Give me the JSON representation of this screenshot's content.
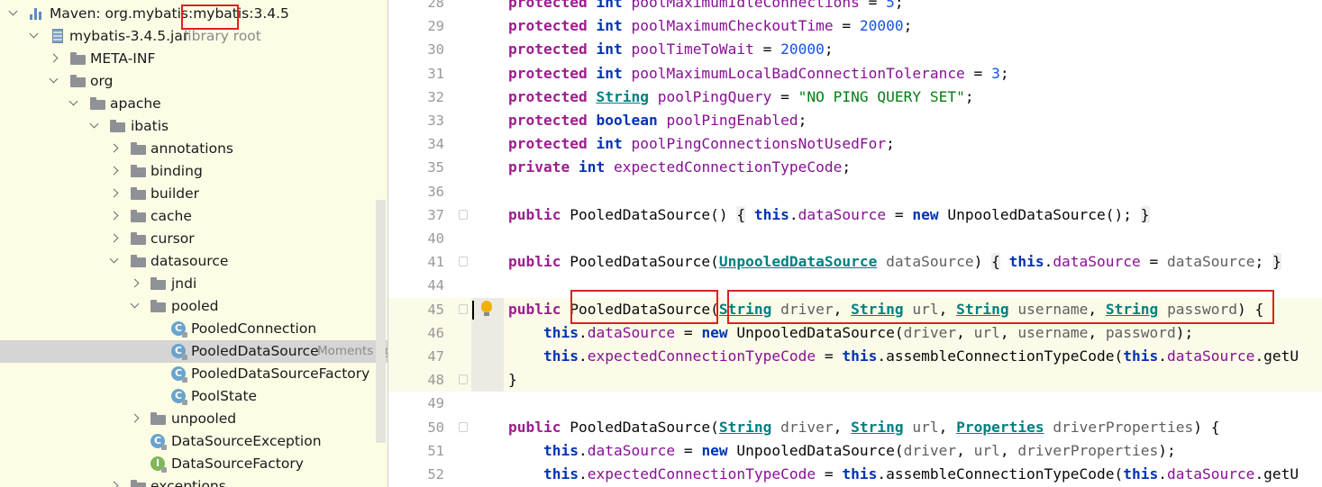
{
  "project_tree": {
    "root": {
      "label": "Maven: org.mybatis:mybatis:3.4.5"
    },
    "jar": {
      "label": "mybatis-3.4.5.jar",
      "hint": "library root"
    },
    "items": [
      {
        "label": "META-INF"
      },
      {
        "label": "org"
      },
      {
        "label": "apache"
      },
      {
        "label": "ibatis"
      },
      {
        "label": "annotations"
      },
      {
        "label": "binding"
      },
      {
        "label": "builder"
      },
      {
        "label": "cache"
      },
      {
        "label": "cursor"
      },
      {
        "label": "datasource"
      },
      {
        "label": "jndi"
      },
      {
        "label": "pooled"
      },
      {
        "label": "PooledConnection"
      },
      {
        "label": "PooledDataSource",
        "hint": "Moments ag"
      },
      {
        "label": "PooledDataSourceFactory"
      },
      {
        "label": "PoolState"
      },
      {
        "label": "unpooled"
      },
      {
        "label": "DataSourceException"
      },
      {
        "label": "DataSourceFactory"
      },
      {
        "label": "exceptions"
      }
    ],
    "icons": {
      "class": "C",
      "interface": "I"
    }
  },
  "editor": {
    "lines": [
      {
        "n": "28",
        "tokens": [
          [
            "k",
            "protected"
          ],
          [
            "t",
            " "
          ],
          [
            "k",
            "int"
          ],
          [
            "t",
            " "
          ],
          [
            "f",
            "poolMaximumIdleConnections"
          ],
          [
            "t",
            " = "
          ],
          [
            "n",
            "5"
          ],
          [
            "t",
            ";"
          ]
        ]
      },
      {
        "n": "29",
        "tokens": [
          [
            "k",
            "protected"
          ],
          [
            "t",
            " "
          ],
          [
            "k",
            "int"
          ],
          [
            "t",
            " "
          ],
          [
            "f",
            "poolMaximumCheckoutTime"
          ],
          [
            "t",
            " = "
          ],
          [
            "n",
            "20000"
          ],
          [
            "t",
            ";"
          ]
        ]
      },
      {
        "n": "30",
        "tokens": [
          [
            "k",
            "protected"
          ],
          [
            "t",
            " "
          ],
          [
            "k",
            "int"
          ],
          [
            "t",
            " "
          ],
          [
            "f",
            "poolTimeToWait"
          ],
          [
            "t",
            " = "
          ],
          [
            "n",
            "20000"
          ],
          [
            "t",
            ";"
          ]
        ]
      },
      {
        "n": "31",
        "tokens": [
          [
            "k",
            "protected"
          ],
          [
            "t",
            " "
          ],
          [
            "k",
            "int"
          ],
          [
            "t",
            " "
          ],
          [
            "f",
            "poolMaximumLocalBadConnectionTolerance"
          ],
          [
            "t",
            " = "
          ],
          [
            "n",
            "3"
          ],
          [
            "t",
            ";"
          ]
        ]
      },
      {
        "n": "32",
        "tokens": [
          [
            "k",
            "protected"
          ],
          [
            "t",
            " "
          ],
          [
            "y",
            "String"
          ],
          [
            "t",
            " "
          ],
          [
            "f",
            "poolPingQuery"
          ],
          [
            "t",
            " = "
          ],
          [
            "s",
            "\"NO PING QUERY SET\""
          ],
          [
            "t",
            ";"
          ]
        ]
      },
      {
        "n": "33",
        "tokens": [
          [
            "k",
            "protected"
          ],
          [
            "t",
            " "
          ],
          [
            "k",
            "boolean"
          ],
          [
            "t",
            " "
          ],
          [
            "f",
            "poolPingEnabled"
          ],
          [
            "t",
            ";"
          ]
        ]
      },
      {
        "n": "34",
        "tokens": [
          [
            "k",
            "protected"
          ],
          [
            "t",
            " "
          ],
          [
            "k",
            "int"
          ],
          [
            "t",
            " "
          ],
          [
            "f",
            "poolPingConnectionsNotUsedFor"
          ],
          [
            "t",
            ";"
          ]
        ]
      },
      {
        "n": "35",
        "tokens": [
          [
            "k",
            "private"
          ],
          [
            "t",
            " "
          ],
          [
            "k",
            "int"
          ],
          [
            "t",
            " "
          ],
          [
            "f",
            "expectedConnectionTypeCode"
          ],
          [
            "t",
            ";"
          ]
        ]
      },
      {
        "n": "36",
        "tokens": []
      },
      {
        "n": "37",
        "tokens": [
          [
            "k",
            "public"
          ],
          [
            "t",
            " PooledDataSource() "
          ],
          [
            "b",
            "{"
          ],
          [
            "t",
            " "
          ],
          [
            "k",
            "this"
          ],
          [
            "t",
            "."
          ],
          [
            "f",
            "dataSource"
          ],
          [
            "t",
            " = "
          ],
          [
            "k",
            "new"
          ],
          [
            "t",
            " UnpooledDataSource(); "
          ],
          [
            "b",
            "}"
          ]
        ]
      },
      {
        "n": "40",
        "tokens": []
      },
      {
        "n": "41",
        "tokens": [
          [
            "k",
            "public"
          ],
          [
            "t",
            " PooledDataSource("
          ],
          [
            "y",
            "UnpooledDataSource"
          ],
          [
            "t",
            " "
          ],
          [
            "p",
            "dataSource"
          ],
          [
            "t",
            ") "
          ],
          [
            "b",
            "{"
          ],
          [
            "t",
            " "
          ],
          [
            "k",
            "this"
          ],
          [
            "t",
            "."
          ],
          [
            "f",
            "dataSource"
          ],
          [
            "t",
            " = "
          ],
          [
            "p",
            "dataSource"
          ],
          [
            "t",
            "; "
          ],
          [
            "b",
            "}"
          ]
        ]
      },
      {
        "n": "44",
        "tokens": []
      },
      {
        "n": "45",
        "tokens": [
          [
            "k",
            "public"
          ],
          [
            "t",
            " PooledDataSource("
          ],
          [
            "y",
            "String"
          ],
          [
            "t",
            " "
          ],
          [
            "p",
            "driver"
          ],
          [
            "t",
            ", "
          ],
          [
            "y",
            "String"
          ],
          [
            "t",
            " "
          ],
          [
            "p",
            "url"
          ],
          [
            "t",
            ", "
          ],
          [
            "y",
            "String"
          ],
          [
            "t",
            " "
          ],
          [
            "p",
            "username"
          ],
          [
            "t",
            ", "
          ],
          [
            "y",
            "String"
          ],
          [
            "t",
            " "
          ],
          [
            "p",
            "password"
          ],
          [
            "t",
            ") {"
          ]
        ]
      },
      {
        "n": "46",
        "tokens": [
          [
            "t",
            "    "
          ],
          [
            "k",
            "this"
          ],
          [
            "t",
            "."
          ],
          [
            "f",
            "dataSource"
          ],
          [
            "t",
            " = "
          ],
          [
            "k",
            "new"
          ],
          [
            "t",
            " UnpooledDataSource("
          ],
          [
            "p",
            "driver"
          ],
          [
            "t",
            ", "
          ],
          [
            "p",
            "url"
          ],
          [
            "t",
            ", "
          ],
          [
            "p",
            "username"
          ],
          [
            "t",
            ", "
          ],
          [
            "p",
            "password"
          ],
          [
            "t",
            ");"
          ]
        ]
      },
      {
        "n": "47",
        "tokens": [
          [
            "t",
            "    "
          ],
          [
            "k",
            "this"
          ],
          [
            "t",
            "."
          ],
          [
            "f",
            "expectedConnectionTypeCode"
          ],
          [
            "t",
            " = "
          ],
          [
            "k",
            "this"
          ],
          [
            "t",
            ".assembleConnectionTypeCode("
          ],
          [
            "k",
            "this"
          ],
          [
            "t",
            "."
          ],
          [
            "f",
            "dataSource"
          ],
          [
            "t",
            ".getU"
          ]
        ]
      },
      {
        "n": "48",
        "tokens": [
          [
            "t",
            "}"
          ]
        ]
      },
      {
        "n": "49",
        "tokens": []
      },
      {
        "n": "50",
        "tokens": [
          [
            "k",
            "public"
          ],
          [
            "t",
            " PooledDataSource("
          ],
          [
            "y",
            "String"
          ],
          [
            "t",
            " "
          ],
          [
            "p",
            "driver"
          ],
          [
            "t",
            ", "
          ],
          [
            "y",
            "String"
          ],
          [
            "t",
            " "
          ],
          [
            "p",
            "url"
          ],
          [
            "t",
            ", "
          ],
          [
            "y",
            "Properties"
          ],
          [
            "t",
            " "
          ],
          [
            "p",
            "driverProperties"
          ],
          [
            "t",
            ") {"
          ]
        ]
      },
      {
        "n": "51",
        "tokens": [
          [
            "t",
            "    "
          ],
          [
            "k",
            "this"
          ],
          [
            "t",
            "."
          ],
          [
            "f",
            "dataSource"
          ],
          [
            "t",
            " = "
          ],
          [
            "k",
            "new"
          ],
          [
            "t",
            " UnpooledDataSource("
          ],
          [
            "p",
            "driver"
          ],
          [
            "t",
            ", "
          ],
          [
            "p",
            "url"
          ],
          [
            "t",
            ", "
          ],
          [
            "p",
            "driverProperties"
          ],
          [
            "t",
            ");"
          ]
        ]
      },
      {
        "n": "52",
        "tokens": [
          [
            "t",
            "    "
          ],
          [
            "k",
            "this"
          ],
          [
            "t",
            "."
          ],
          [
            "f",
            "expectedConnectionTypeCode"
          ],
          [
            "t",
            " = "
          ],
          [
            "k",
            "this"
          ],
          [
            "t",
            ".assembleConnectionTypeCode("
          ],
          [
            "k",
            "this"
          ],
          [
            "t",
            "."
          ],
          [
            "f",
            "dataSource"
          ],
          [
            "t",
            ".getU"
          ]
        ]
      }
    ]
  }
}
